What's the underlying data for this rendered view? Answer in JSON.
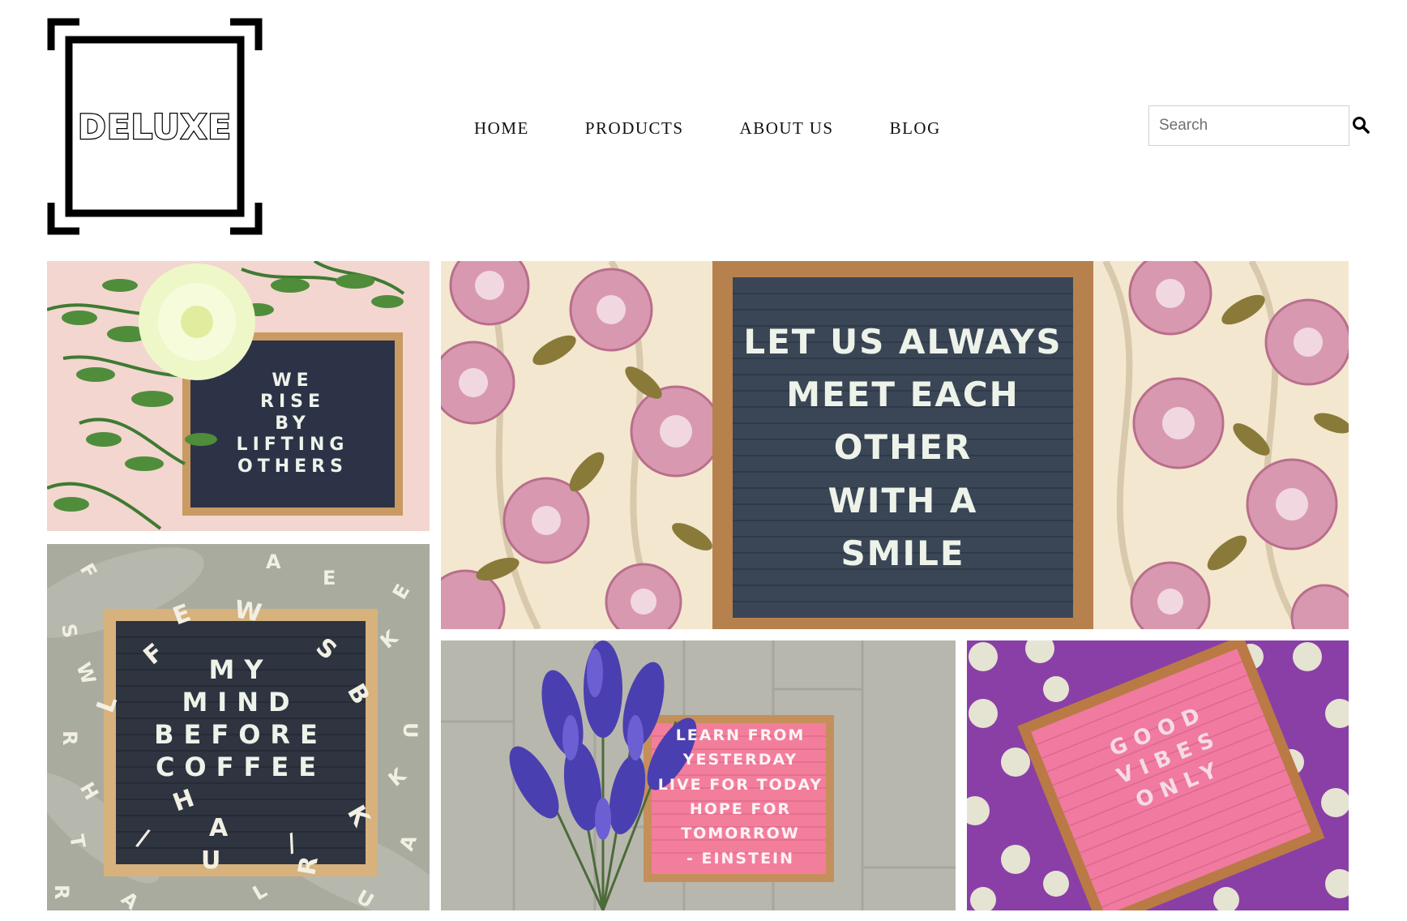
{
  "brand": {
    "logo_text": "DELUXE",
    "logo_icon": "bracket-frame-logo"
  },
  "nav": {
    "items": [
      {
        "label": "HOME"
      },
      {
        "label": "PRODUCTS"
      },
      {
        "label": "ABOUT US"
      },
      {
        "label": "BLOG"
      }
    ]
  },
  "search": {
    "placeholder": "Search",
    "value": "",
    "icon": "search-icon"
  },
  "gallery": {
    "tiles": [
      {
        "board_lines": [
          "WE",
          "RISE",
          "BY",
          "LIFTING",
          "OTHERS"
        ],
        "board_color": "#2c3347",
        "background": "pink-with-greenery-and-flower"
      },
      {
        "board_lines": [
          "LET US ALWAYS",
          "MEET EACH OTHER",
          "WITH A",
          "SMILE"
        ],
        "board_color": "#3a4656",
        "background": "rose-wallpaper"
      },
      {
        "board_lines": [
          "MY",
          "MIND",
          "BEFORE",
          "COFFEE"
        ],
        "board_color": "#2e3440",
        "background": "grey-cloth-with-letters"
      },
      {
        "board_lines": [
          "LEARN FROM",
          "YESTERDAY",
          "LIVE FOR TODAY",
          "HOPE FOR",
          "TOMORROW",
          "- EINSTEIN"
        ],
        "board_color": "#f27e9b",
        "background": "wood-floor-with-lavender"
      },
      {
        "board_lines": [
          "GOOD",
          "VIBES",
          "ONLY"
        ],
        "board_color": "#f07aa0",
        "background": "purple-polka-dot"
      }
    ]
  },
  "colors": {
    "frame_wood": "#b98a56",
    "text_primary": "#111111",
    "search_border": "#cfcfcf"
  }
}
